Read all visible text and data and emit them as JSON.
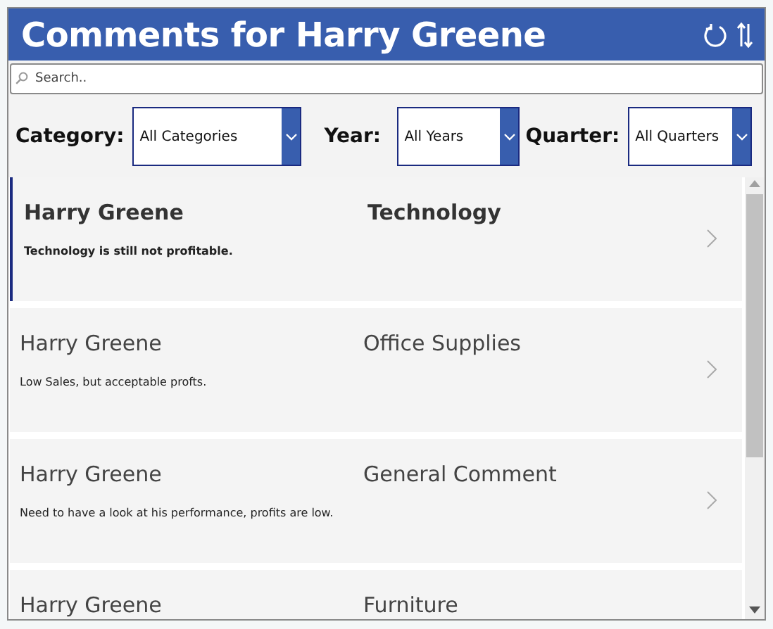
{
  "header": {
    "title": "Comments for Harry Greene"
  },
  "search": {
    "placeholder": "Search.."
  },
  "filters": [
    {
      "label": "Category:",
      "value": "All Categories"
    },
    {
      "label": "Year:",
      "value": "All Years"
    },
    {
      "label": "Quarter:",
      "value": "All Quarters"
    }
  ],
  "comments": [
    {
      "name": "Harry Greene",
      "category": "Technology",
      "comment": "Technology is still not profitable.",
      "selected": true
    },
    {
      "name": "Harry Greene",
      "category": "Office Supplies",
      "comment": "Low Sales, but acceptable profts.",
      "selected": false
    },
    {
      "name": "Harry Greene",
      "category": "General Comment",
      "comment": "Need to have a look at his performance, profits are low.",
      "selected": false
    },
    {
      "name": "Harry Greene",
      "category": "Furniture",
      "selected": false
    }
  ]
}
